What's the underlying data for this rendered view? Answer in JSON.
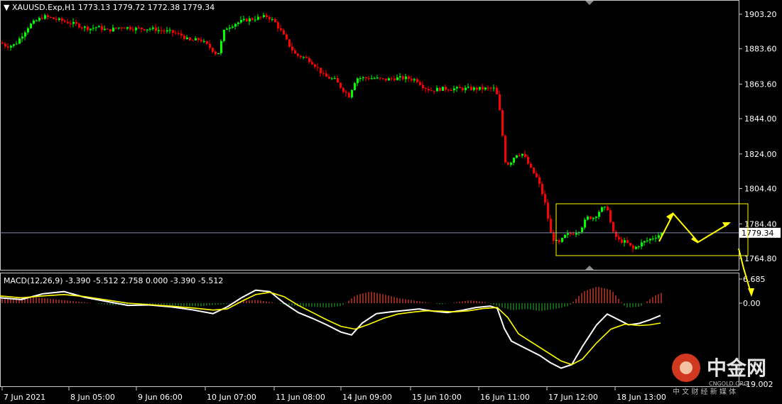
{
  "header": {
    "symbol_line": "XAUUSD.Exp,H1  1773.13 1779.72 1772.38 1779.34"
  },
  "macd": {
    "label": "MACD(12,26,9) -3.390 -5.512 2.758 0.000 -3.390 -5.512"
  },
  "watermark": {
    "brand_cn": "中金网",
    "brand_en": "CNGOLD.ORG",
    "tagline_cn": "中 文 财 经 新 媒 体"
  },
  "colors": {
    "background": "#000000",
    "bull": "#00ff00",
    "bear": "#ff0000",
    "hist_pos": "#c0392b",
    "hist_neg": "#1f7a1f",
    "macd_line": "#ffffff",
    "signal_line": "#ffff00",
    "annotation": "#ffff00",
    "price_line": "#7f8caa"
  },
  "chart_data": {
    "type": "candlestick",
    "instrument": "XAUUSD.Exp",
    "timeframe": "H1",
    "last_bar": {
      "open": 1773.13,
      "high": 1779.72,
      "low": 1772.38,
      "close": 1779.34
    },
    "current_price": "1779.34",
    "y_ticks": [
      "1903.20",
      "1883.60",
      "1863.60",
      "1844.00",
      "1824.00",
      "1804.40",
      "1784.40",
      "1764.80"
    ],
    "y_range": [
      1758,
      1910
    ],
    "x_ticks": [
      "7 Jun 2021",
      "8 Jun 05:00",
      "9 Jun 06:00",
      "10 Jun 07:00",
      "11 Jun 08:00",
      "14 Jun 09:00",
      "15 Jun 10:00",
      "16 Jun 11:00",
      "17 Jun 12:00",
      "18 Jun 13:00"
    ],
    "price_path": [
      [
        0,
        1887
      ],
      [
        8,
        1885
      ],
      [
        20,
        1886
      ],
      [
        40,
        1897
      ],
      [
        60,
        1902
      ],
      [
        80,
        1900
      ],
      [
        100,
        1898
      ],
      [
        115,
        1896
      ],
      [
        125,
        1895
      ],
      [
        135,
        1896
      ],
      [
        150,
        1894
      ],
      [
        170,
        1896
      ],
      [
        190,
        1895
      ],
      [
        210,
        1895
      ],
      [
        225,
        1894
      ],
      [
        240,
        1893
      ],
      [
        255,
        1891
      ],
      [
        265,
        1888
      ],
      [
        280,
        1889
      ],
      [
        295,
        1884
      ],
      [
        305,
        1880
      ],
      [
        315,
        1895
      ],
      [
        330,
        1898
      ],
      [
        345,
        1900
      ],
      [
        360,
        1901
      ],
      [
        375,
        1902
      ],
      [
        385,
        1899
      ],
      [
        395,
        1893
      ],
      [
        405,
        1886
      ],
      [
        415,
        1880
      ],
      [
        425,
        1879
      ],
      [
        435,
        1877
      ],
      [
        445,
        1873
      ],
      [
        455,
        1868
      ],
      [
        470,
        1866
      ],
      [
        480,
        1861
      ],
      [
        490,
        1857
      ],
      [
        500,
        1867
      ],
      [
        510,
        1867
      ],
      [
        525,
        1867
      ],
      [
        540,
        1866
      ],
      [
        555,
        1867
      ],
      [
        570,
        1867
      ],
      [
        585,
        1866
      ],
      [
        595,
        1862
      ],
      [
        605,
        1860
      ],
      [
        620,
        1861
      ],
      [
        635,
        1861
      ],
      [
        650,
        1861
      ],
      [
        665,
        1861
      ],
      [
        680,
        1861
      ],
      [
        695,
        1861
      ],
      [
        700,
        1855
      ],
      [
        705,
        1838
      ],
      [
        710,
        1820
      ],
      [
        715,
        1818
      ],
      [
        725,
        1824
      ],
      [
        735,
        1824
      ],
      [
        745,
        1816
      ],
      [
        755,
        1810
      ],
      [
        765,
        1798
      ],
      [
        775,
        1777
      ],
      [
        785,
        1773
      ],
      [
        795,
        1778
      ],
      [
        805,
        1779
      ],
      [
        815,
        1781
      ],
      [
        825,
        1788
      ],
      [
        835,
        1788
      ],
      [
        845,
        1793
      ],
      [
        855,
        1793
      ],
      [
        860,
        1780
      ],
      [
        870,
        1775
      ],
      [
        880,
        1774
      ],
      [
        890,
        1770
      ],
      [
        900,
        1773
      ],
      [
        910,
        1775
      ],
      [
        920,
        1777
      ],
      [
        930,
        1779
      ]
    ],
    "macd_ticks": [
      "6.685",
      "0.00",
      "-19.002"
    ],
    "macd_range": [
      -20,
      8
    ],
    "histogram": [
      [
        0,
        1.6
      ],
      [
        20,
        1.4
      ],
      [
        40,
        1.8
      ],
      [
        60,
        1.4
      ],
      [
        80,
        1.0
      ],
      [
        100,
        0.6
      ],
      [
        120,
        0.2
      ],
      [
        140,
        -0.2
      ],
      [
        160,
        -0.6
      ],
      [
        180,
        -0.3
      ],
      [
        200,
        -0.2
      ],
      [
        220,
        -0.3
      ],
      [
        240,
        -0.6
      ],
      [
        260,
        -0.8
      ],
      [
        280,
        -0.9
      ],
      [
        300,
        -0.5
      ],
      [
        320,
        -0.2
      ],
      [
        340,
        0.6
      ],
      [
        360,
        0.9
      ],
      [
        380,
        0.3
      ],
      [
        400,
        -0.4
      ],
      [
        420,
        -0.9
      ],
      [
        440,
        -1.0
      ],
      [
        460,
        -1.2
      ],
      [
        480,
        -0.8
      ],
      [
        500,
        2.2
      ],
      [
        520,
        3.2
      ],
      [
        540,
        2.4
      ],
      [
        560,
        1.4
      ],
      [
        580,
        0.8
      ],
      [
        600,
        0.2
      ],
      [
        620,
        -0.3
      ],
      [
        640,
        0.2
      ],
      [
        660,
        0.8
      ],
      [
        680,
        0.4
      ],
      [
        700,
        -0.8
      ],
      [
        720,
        -2.0
      ],
      [
        740,
        -1.6
      ],
      [
        760,
        -2.2
      ],
      [
        780,
        -1.6
      ],
      [
        800,
        -0.8
      ],
      [
        820,
        3.2
      ],
      [
        840,
        4.6
      ],
      [
        860,
        3.6
      ],
      [
        880,
        -1.2
      ],
      [
        900,
        -1.0
      ],
      [
        920,
        2.0
      ],
      [
        930,
        2.8
      ]
    ],
    "macd_line": [
      [
        0,
        1.5
      ],
      [
        30,
        1.0
      ],
      [
        60,
        2.6
      ],
      [
        90,
        3.2
      ],
      [
        120,
        1.6
      ],
      [
        150,
        0.5
      ],
      [
        180,
        -0.6
      ],
      [
        210,
        -0.5
      ],
      [
        240,
        -1.0
      ],
      [
        270,
        -1.8
      ],
      [
        300,
        -2.9
      ],
      [
        320,
        -1.0
      ],
      [
        340,
        1.5
      ],
      [
        360,
        3.6
      ],
      [
        380,
        3.2
      ],
      [
        400,
        0
      ],
      [
        420,
        -2.6
      ],
      [
        440,
        -4.2
      ],
      [
        460,
        -6.0
      ],
      [
        480,
        -8.0
      ],
      [
        495,
        -8.8
      ],
      [
        510,
        -5.5
      ],
      [
        530,
        -2.9
      ],
      [
        550,
        -2.4
      ],
      [
        570,
        -2.0
      ],
      [
        590,
        -1.6
      ],
      [
        610,
        -2.2
      ],
      [
        630,
        -2.6
      ],
      [
        650,
        -2.0
      ],
      [
        670,
        -1.2
      ],
      [
        690,
        -0.8
      ],
      [
        700,
        -1.4
      ],
      [
        710,
        -7.0
      ],
      [
        720,
        -10.5
      ],
      [
        740,
        -12.5
      ],
      [
        760,
        -14.5
      ],
      [
        775,
        -16.5
      ],
      [
        790,
        -18.0
      ],
      [
        805,
        -17.0
      ],
      [
        820,
        -12.0
      ],
      [
        840,
        -6.0
      ],
      [
        855,
        -3.0
      ],
      [
        870,
        -4.5
      ],
      [
        885,
        -6.0
      ],
      [
        900,
        -5.6
      ],
      [
        915,
        -4.6
      ],
      [
        930,
        -3.4
      ]
    ],
    "signal_line": [
      [
        0,
        2.0
      ],
      [
        30,
        1.5
      ],
      [
        60,
        2.0
      ],
      [
        90,
        2.4
      ],
      [
        120,
        1.8
      ],
      [
        150,
        0.9
      ],
      [
        180,
        0
      ],
      [
        210,
        -0.4
      ],
      [
        240,
        -0.8
      ],
      [
        270,
        -1.3
      ],
      [
        300,
        -1.9
      ],
      [
        320,
        -1.6
      ],
      [
        340,
        0.5
      ],
      [
        360,
        2.4
      ],
      [
        380,
        3.0
      ],
      [
        400,
        1.8
      ],
      [
        420,
        -0.6
      ],
      [
        440,
        -2.6
      ],
      [
        460,
        -4.6
      ],
      [
        480,
        -6.4
      ],
      [
        500,
        -7.2
      ],
      [
        520,
        -5.8
      ],
      [
        540,
        -4.2
      ],
      [
        560,
        -3.0
      ],
      [
        580,
        -2.5
      ],
      [
        600,
        -2.1
      ],
      [
        620,
        -2.2
      ],
      [
        640,
        -2.4
      ],
      [
        660,
        -2.1
      ],
      [
        680,
        -1.5
      ],
      [
        700,
        -1.2
      ],
      [
        715,
        -4.0
      ],
      [
        730,
        -8.5
      ],
      [
        750,
        -11.0
      ],
      [
        770,
        -13.5
      ],
      [
        790,
        -16.0
      ],
      [
        805,
        -17.0
      ],
      [
        820,
        -15.5
      ],
      [
        840,
        -11.0
      ],
      [
        860,
        -7.2
      ],
      [
        880,
        -5.8
      ],
      [
        900,
        -6.2
      ],
      [
        915,
        -6.0
      ],
      [
        930,
        -5.5
      ]
    ]
  }
}
